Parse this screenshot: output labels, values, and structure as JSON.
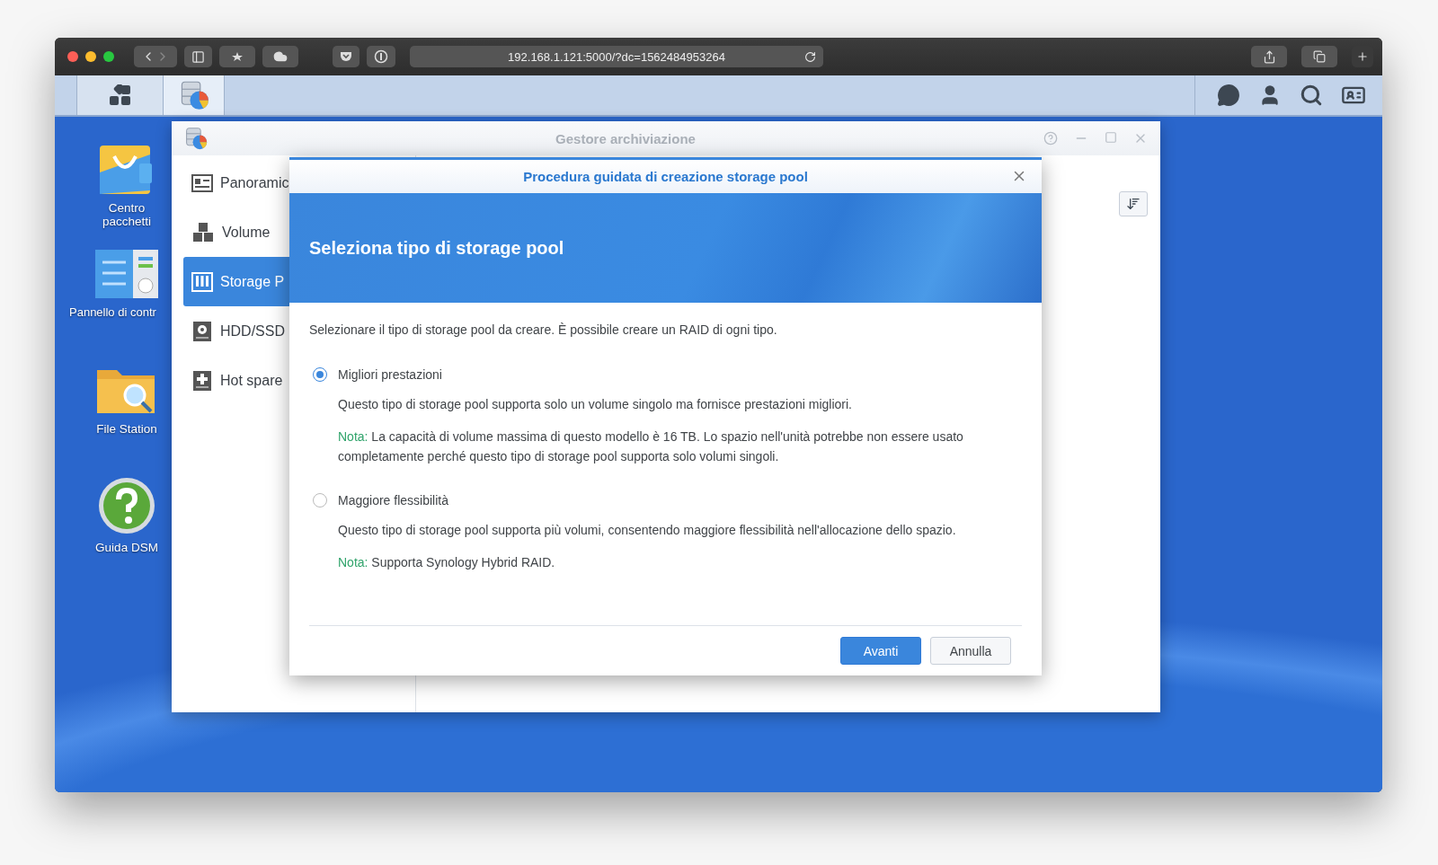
{
  "browser": {
    "url": "192.168.1.121:5000/?dc=1562484953264"
  },
  "desktop_icons": [
    {
      "kind": "package",
      "label": "Centro pacchetti"
    },
    {
      "kind": "control",
      "label": "Pannello di contr"
    },
    {
      "kind": "files",
      "label": "File Station"
    },
    {
      "kind": "help",
      "label": "Guida DSM"
    }
  ],
  "app_window": {
    "title": "Gestore archiviazione",
    "sidebar": [
      {
        "kind": "overview",
        "label": "Panoramic",
        "selected": false
      },
      {
        "kind": "volume",
        "label": "Volume",
        "selected": false
      },
      {
        "kind": "pool",
        "label": "Storage P",
        "selected": true
      },
      {
        "kind": "disk",
        "label": "HDD/SSD",
        "selected": false
      },
      {
        "kind": "spare",
        "label": "Hot spare",
        "selected": false
      }
    ]
  },
  "dialog": {
    "title": "Procedura guidata di creazione storage pool",
    "heading": "Seleziona tipo di storage pool",
    "intro": "Selezionare il tipo di storage pool da creare. È possibile creare un RAID di ogni tipo.",
    "options": [
      {
        "label": "Migliori prestazioni",
        "selected": true,
        "description": "Questo tipo di storage pool supporta solo un volume singolo ma fornisce prestazioni migliori.",
        "note_label": "Nota:",
        "note": "La capacità di volume massima di questo modello è 16 TB. Lo spazio nell'unità potrebbe non essere usato completamente perché questo tipo di storage pool supporta solo volumi singoli."
      },
      {
        "label": "Maggiore flessibilità",
        "selected": false,
        "description": "Questo tipo di storage pool supporta più volumi, consentendo maggiore flessibilità nell'allocazione dello spazio.",
        "note_label": "Nota:",
        "note": "Supporta Synology Hybrid RAID."
      }
    ],
    "buttons": [
      {
        "kind": "primary",
        "label": "Avanti"
      },
      {
        "kind": "secondary",
        "label": "Annulla"
      }
    ]
  }
}
